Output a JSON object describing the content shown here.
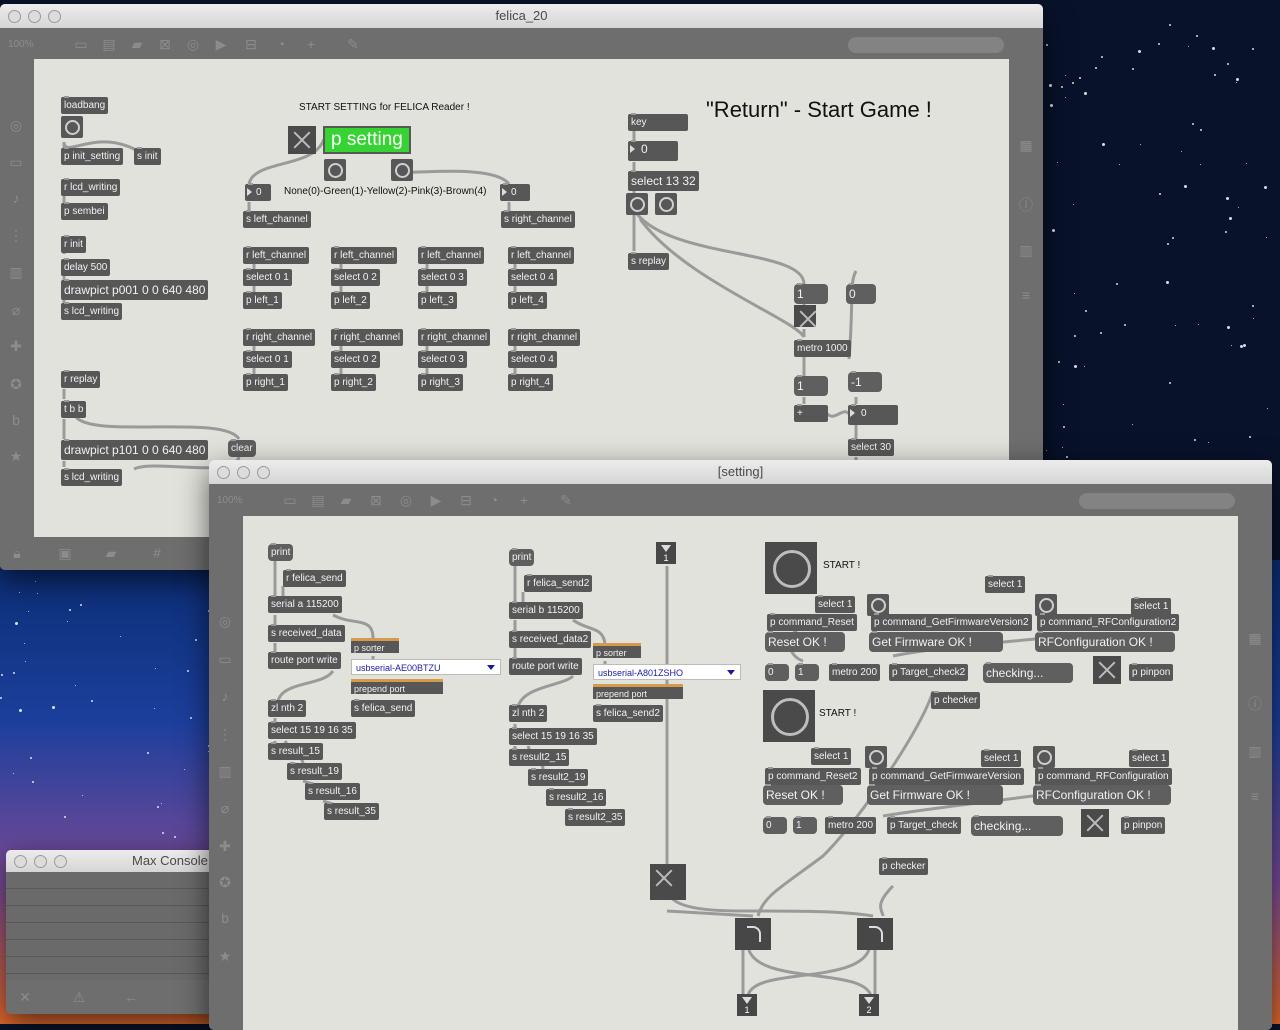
{
  "desktop": {
    "background": "#08122a"
  },
  "main_window": {
    "title": "felica_20",
    "zoom": "100%",
    "patch": {
      "left": {
        "loadbang": "loadbang",
        "init_setting": "p init_setting",
        "s_init": "s init",
        "r_lcd_writing": "r lcd_writing",
        "sembei": "p sembei",
        "r_init": "r init",
        "delay": "delay 500",
        "drawpict1": "drawpict p001 0 0 640 480",
        "s_lcd_writing1": "s lcd_writing",
        "r_replay": "r replay",
        "tbb": "t b b",
        "drawpict2": "drawpict p101 0 0 640 480",
        "clear": "clear",
        "s_lcd_writing2": "s lcd_writing"
      },
      "center": {
        "start_setting": "START SETTING for FELICA Reader !",
        "p_setting": "p setting",
        "color_legend": "None(0)-Green(1)-Yellow(2)-Pink(3)-Brown(4)",
        "num_left": "0",
        "num_right": "0",
        "s_left_channel": "s left_channel",
        "s_right_channel": "s right_channel",
        "left_groups": [
          {
            "r": "r left_channel",
            "sel": "select 0 1",
            "p": "p left_1"
          },
          {
            "r": "r left_channel",
            "sel": "select 0 2",
            "p": "p left_2"
          },
          {
            "r": "r left_channel",
            "sel": "select 0 3",
            "p": "p left_3"
          },
          {
            "r": "r left_channel",
            "sel": "select 0 4",
            "p": "p left_4"
          }
        ],
        "right_groups": [
          {
            "r": "r right_channel",
            "sel": "select 0 1",
            "p": "p right_1"
          },
          {
            "r": "r right_channel",
            "sel": "select 0 2",
            "p": "p right_2"
          },
          {
            "r": "r right_channel",
            "sel": "select 0 3",
            "p": "p right_3"
          },
          {
            "r": "r right_channel",
            "sel": "select 0 4",
            "p": "p right_4"
          }
        ]
      },
      "right": {
        "key": "key",
        "key_num": "0",
        "select": "select 13 32",
        "s_replay": "s replay",
        "heading": "\"Return\" - Start Game !",
        "msg1": "1",
        "msg0": "0",
        "metro": "metro 1000",
        "one": "1",
        "minus1": "-1",
        "plus": "+",
        "counter": "0",
        "select30": "select 30"
      }
    }
  },
  "setting_window": {
    "title": "[setting]",
    "zoom": "100%",
    "col_a": {
      "print": "print",
      "r_felica_send": "r felica_send",
      "serial": "serial a 115200",
      "s_received": "s received_data",
      "p_sorter": "p sorter",
      "route": "route port write",
      "port_menu": "usbserial-AE00BTZU",
      "prepend": "prepend port",
      "s_felica_send": "s felica_send",
      "zl": "zl nth 2",
      "select": "select 15 19 16 35",
      "results": [
        "s result_15",
        "s result_19",
        "s result_16",
        "s result_35"
      ]
    },
    "col_b": {
      "print": "print",
      "r_felica_send": "r felica_send2",
      "serial": "serial b 115200",
      "s_received": "s received_data2",
      "p_sorter": "p sorter",
      "route": "route port write",
      "port_menu": "usbserial-A801ZSHO",
      "prepend": "prepend port",
      "s_felica_send": "s felica_send2",
      "zl": "zl nth 2",
      "select": "select 15 19 16 35",
      "results": [
        "s result2_15",
        "s result2_19",
        "s result2_16",
        "s result2_35"
      ]
    },
    "inlet1": "1",
    "outlet1": "1",
    "outlet2": "2",
    "block1": {
      "start": "START !",
      "sel1a": "select 1",
      "sel1b": "select 1",
      "sel1c": "select 1",
      "cmd_reset": "p command_Reset",
      "cmd_fw": "p command_GetFirmwareVersion2",
      "cmd_rf": "p command_RFConfiguration2",
      "reset_ok": "Reset OK !",
      "fw_ok": "Get Firmware OK !",
      "rf_ok": "RFConfiguration OK !",
      "n0": "0",
      "n1": "1",
      "metro": "metro 200",
      "target": "p Target_check2",
      "checking": "checking...",
      "pinpon": "p pinpon",
      "checker": "p checker"
    },
    "block2": {
      "start": "START !",
      "sel1a": "select 1",
      "sel1b": "select 1",
      "sel1c": "select 1",
      "cmd_reset": "p command_Reset2",
      "cmd_fw": "p command_GetFirmwareVersion",
      "cmd_rf": "p command_RFConfiguration",
      "reset_ok": "Reset OK !",
      "fw_ok": "Get Firmware OK !",
      "rf_ok": "RFConfiguration OK !",
      "n0": "0",
      "n1": "1",
      "metro": "metro 200",
      "target": "p Target_check",
      "checking": "checking...",
      "pinpon": "p pinpon",
      "checker": "p checker"
    }
  },
  "console_window": {
    "title": "Max Console"
  },
  "colors": {
    "canvas": "#e1e2db",
    "object": "#575757",
    "green_button": "#36d433",
    "menu_text": "#1a1aa0"
  }
}
